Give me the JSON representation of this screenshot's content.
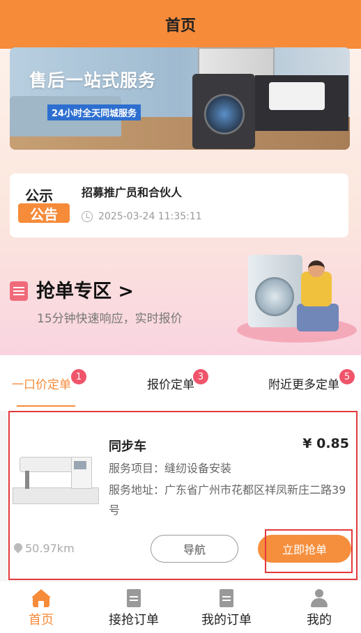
{
  "header": {
    "title": "首页"
  },
  "banner": {
    "title": "售后一站式服务",
    "badge": "24小时全天同城服务"
  },
  "notice": {
    "icon_top": "公示",
    "icon_bottom": "公告",
    "title": "招募推广员和合伙人",
    "time": "2025-03-24 11:35:11"
  },
  "grab_zone": {
    "title": "抢单专区 >",
    "subtitle": "15分钟快速响应，实时报价"
  },
  "order_tabs": [
    {
      "label": "一口价定单",
      "badge": "1",
      "active": true
    },
    {
      "label": "报价定单",
      "badge": "3",
      "active": false
    },
    {
      "label": "附近更多定单",
      "badge": "5",
      "active": false
    }
  ],
  "order_card": {
    "title": "同步车",
    "price": "¥ 0.85",
    "service_item": "服务项目：缝纫设备安装",
    "service_address": "服务地址：广东省广州市花都区祥凤新庄二路39号",
    "distance": "50.97km",
    "nav_button": "导航",
    "grab_button": "立即抢单"
  },
  "tabbar": [
    {
      "label": "首页",
      "icon": "home-icon",
      "active": true
    },
    {
      "label": "接抢订单",
      "icon": "document-icon",
      "active": false
    },
    {
      "label": "我的订单",
      "icon": "document-icon",
      "active": false
    },
    {
      "label": "我的",
      "icon": "user-icon",
      "active": false
    }
  ],
  "colors": {
    "accent": "#f68b3a",
    "badge": "#f0546a",
    "highlight_frame": "#e4393c"
  }
}
